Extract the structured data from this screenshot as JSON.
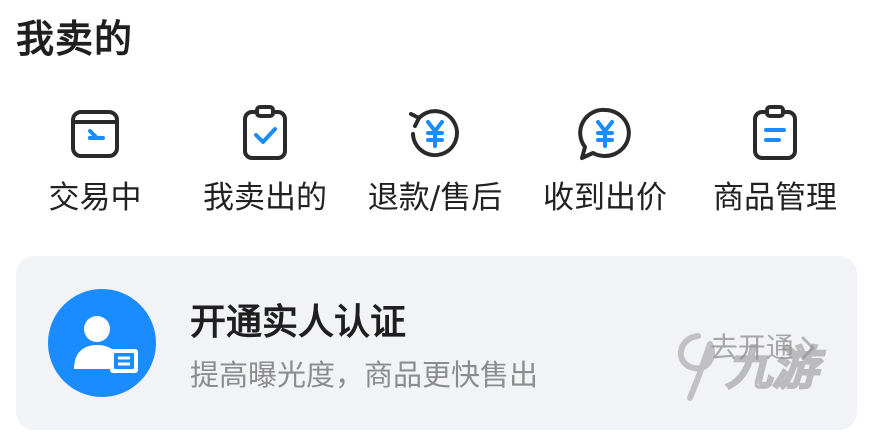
{
  "section": {
    "title": "我卖的"
  },
  "quick_actions": [
    {
      "label": "交易中",
      "icon": "trading-box-icon"
    },
    {
      "label": "我卖出的",
      "icon": "clipboard-check-icon"
    },
    {
      "label": "退款/售后",
      "icon": "refund-yen-icon"
    },
    {
      "label": "收到出价",
      "icon": "chat-yen-icon"
    },
    {
      "label": "商品管理",
      "icon": "clipboard-list-icon"
    }
  ],
  "verify_card": {
    "title": "开通实人认证",
    "subtitle": "提高曝光度，商品更快售出",
    "action_label": "去开通",
    "icon": "user-id-badge-icon"
  },
  "watermark": {
    "text": "九游",
    "icon": "jiuyou-logo-icon"
  },
  "colors": {
    "accent_blue": "#1a8cff",
    "icon_dark": "#2a2a2a",
    "card_bg": "#f2f3f7",
    "title_text": "#1f1f1f",
    "muted_text": "#8c8c8c"
  }
}
